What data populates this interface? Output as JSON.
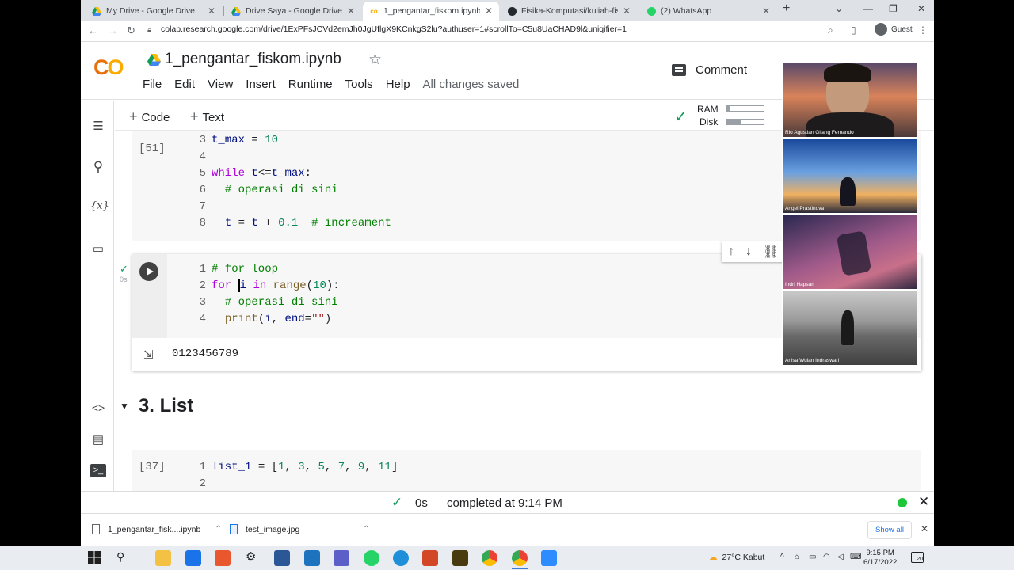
{
  "tabs": [
    {
      "title": "My Drive - Google Drive",
      "favicon": "google-drive-icon",
      "active": false
    },
    {
      "title": "Drive Saya - Google Drive",
      "favicon": "google-drive-icon",
      "active": false
    },
    {
      "title": "1_pengantar_fiskom.ipynb - Col",
      "favicon": "colab-icon",
      "active": true
    },
    {
      "title": "Fisika-Komputasi/kuliah-fiskom",
      "favicon": "github-icon",
      "active": false
    },
    {
      "title": "(2) WhatsApp",
      "favicon": "whatsapp-icon",
      "active": false
    }
  ],
  "address_bar": {
    "url": "colab.research.google.com/drive/1ExPFsJCVd2emJh0JgUflgX9KCnkgS2lu?authuser=1#scrollTo=C5u8UaCHAD9l&uniqifier=1",
    "profile": "Guest"
  },
  "colab": {
    "logo": "CO",
    "notebook_title": "1_pengantar_fiskom.ipynb",
    "menu": [
      "File",
      "Edit",
      "View",
      "Insert",
      "Runtime",
      "Tools",
      "Help"
    ],
    "save_status": "All changes saved",
    "comment_label": "Comment",
    "add_code": "Code",
    "add_text": "Text",
    "ram_label": "RAM",
    "disk_label": "Disk",
    "ram_usage": 0.06,
    "disk_usage": 0.4
  },
  "cells": {
    "cell1": {
      "exec_count": "[51]",
      "lines": [
        {
          "n": "3",
          "code": "t_max = 10"
        },
        {
          "n": "4",
          "code": ""
        },
        {
          "n": "5",
          "code": "while t<=t_max:"
        },
        {
          "n": "6",
          "code": "  # operasi di sini"
        },
        {
          "n": "7",
          "code": ""
        },
        {
          "n": "8",
          "code": "  t = t + 0.1  # increament"
        }
      ]
    },
    "cell2": {
      "exec_time": "0s",
      "lines": [
        {
          "n": "1",
          "code": "# for loop"
        },
        {
          "n": "2",
          "code": "for i in range(10):"
        },
        {
          "n": "3",
          "code": "  # operasi di sini"
        },
        {
          "n": "4",
          "code": "  print(i, end=\"\")"
        }
      ],
      "output": "0123456789"
    },
    "section_heading": "3. List",
    "cell3": {
      "exec_count": "[37]",
      "lines": [
        {
          "n": "1",
          "code": "list_1 = [1, 3, 5, 7, 9, 11]"
        },
        {
          "n": "2",
          "code": ""
        }
      ]
    }
  },
  "status_bar": {
    "exec_time": "0s",
    "message": "completed at 9:14 PM",
    "status_color": "#1ec639"
  },
  "downloads": {
    "items": [
      "1_pengantar_fisk....ipynb",
      "test_image.jpg"
    ],
    "show_all": "Show all"
  },
  "video_call": {
    "participants": [
      "Rio Agustian Gilang Fernando",
      "Angel Prastinova",
      "Indri Hapsari",
      "Anisa Wulan Indraswari"
    ]
  },
  "taskbar": {
    "weather": "27°C  Kabut",
    "time": "9:15 PM",
    "date": "6/17/2022",
    "notification_count": "20"
  }
}
